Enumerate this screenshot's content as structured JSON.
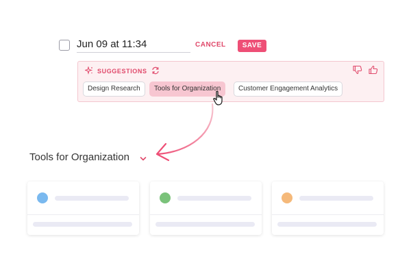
{
  "task": {
    "title": "Jun 09 at 11:34",
    "cancel_label": "CANCEL",
    "save_label": "SAVE"
  },
  "suggestions": {
    "header": "SUGGESTIONS",
    "chips": [
      "Design Research",
      "Tools for Organization",
      "Customer Engagement Analytics"
    ],
    "selected": "Tools for Organization"
  },
  "section": {
    "title": "Tools for Organization"
  },
  "cards": [
    {
      "dot_color": "#7ab9ef"
    },
    {
      "dot_color": "#7ac27a"
    },
    {
      "dot_color": "#f5b97a"
    }
  ],
  "colors": {
    "accent": "#ee4f76",
    "panel_bg": "#fdf0f2",
    "chip_selected": "#f7c6d1"
  },
  "icons": [
    "checkbox-icon",
    "sparkle-icon",
    "refresh-icon",
    "thumbs-down-icon",
    "thumbs-up-icon",
    "pointer-cursor-icon",
    "arrow-icon",
    "chevron-down-icon"
  ]
}
